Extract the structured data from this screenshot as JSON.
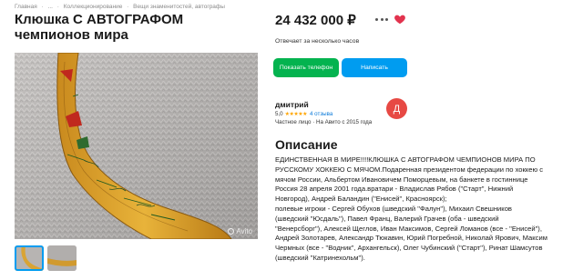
{
  "breadcrumb": [
    "Главная",
    "·",
    "...",
    "·",
    "Коллекционирование",
    "·",
    "Вещи знаменитостей, автографы"
  ],
  "listing": {
    "title": "Клюшка С АВТОГРАФОМ чемпионов мира",
    "price": "24 432 000 ₽",
    "reply_note": "Отвечает за несколько часов"
  },
  "actions": {
    "phone_label": "Показать телефон",
    "message_label": "Написать"
  },
  "seller": {
    "name": "дмитрий",
    "rating": "5,0",
    "stars": "★★★★★",
    "reviews": "4 отзыва",
    "since": "Частное лицо · На Авито с 2015 года",
    "avatar_letter": "Д"
  },
  "description": {
    "heading": "Описание",
    "lines": [
      "ЕДИНСТВЕННАЯ В МИРЕ!!!!КЛЮШКА С АВТОГРАФОМ ЧЕМПИОНОВ МИРА ПО",
      "РУССКОМУ ХОККЕЮ С МЯЧОМ.Подаренная президентом федерации по хоккею с",
      "мячом России, Альбертом Ивановичем Поморцевым, на банкете в гостиннице",
      "Россия 28 апреля 2001 года.вратари - Владислав Рябов (\"Старт\", Нижний",
      "Новгород), Андрей Баландин (\"Енисей\", Красноярск);",
      "полевые игроки - Сергей Обухов (шведский \"Фалун\"), Михаил Свешников",
      "(шведский \"Юсдаль\"), Павел Франц, Валерий Грачев (оба - шведский",
      "\"Венерсборг\"), Алексей Щеглов, Иван Максимов, Сергей Ломанов (все - \"Енисей\"),",
      "Андрей Золотарев, Александр Тюкавин, Юрий Погребной, Николай Ярович, Максим",
      "Чермных (все - \"Водник\", Архангельск), Олег Чубинский (\"Старт\"), Ринат Шамсутов",
      "(шведский \"Катринехольм\")."
    ]
  },
  "photo": {
    "watermark": "Avito"
  },
  "colors": {
    "phone_button": "#04b34f",
    "message_button": "#009cf0",
    "heart": "#e2334e",
    "avatar": "#e74944",
    "stars": "#ffa400"
  },
  "icons": {
    "more": "more-dots-icon",
    "favorite": "heart-icon"
  }
}
